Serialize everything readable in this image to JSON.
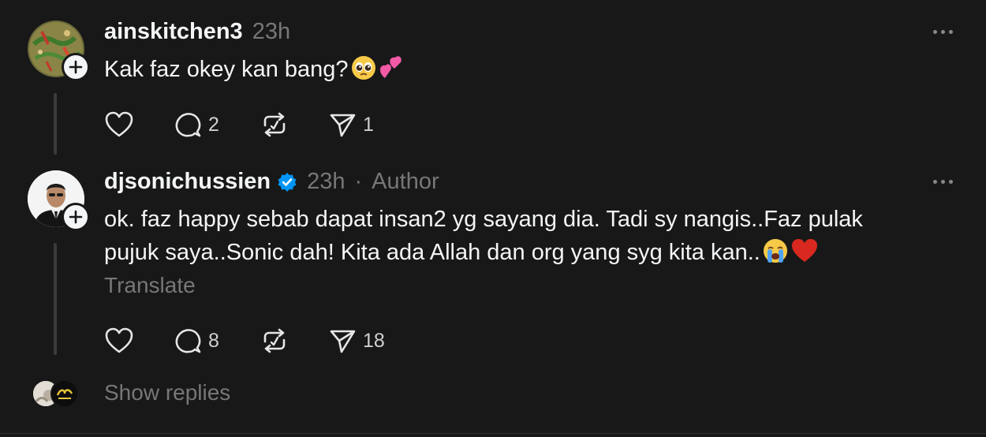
{
  "comments": [
    {
      "username": "ainskitchen3",
      "time": "23h",
      "text": "Kak faz okey kan bang?",
      "emojis": [
        "pleading-face-emoji",
        "two-hearts-emoji"
      ],
      "likes": "",
      "replies": "2",
      "reposts": "",
      "shares": "1"
    },
    {
      "username": "djsonichussien",
      "time": "23h",
      "separator": "·",
      "author_label": "Author",
      "text_line1": "ok. faz happy sebab dapat insan2 yg sayang dia. Tadi sy nangis..Faz pulak",
      "text_line2": "pujuk saya..Sonic dah! Kita ada Allah dan org yang syg kita kan..",
      "emojis": [
        "loudly-crying-face-emoji",
        "red-heart-emoji"
      ],
      "translate": "Translate",
      "likes": "",
      "replies": "8",
      "reposts": "",
      "shares": "18"
    }
  ],
  "show_replies": "Show replies",
  "colors": {
    "background": "#181818",
    "text": "#f3f5f7",
    "muted": "#777777",
    "verified": "#0095f6"
  }
}
